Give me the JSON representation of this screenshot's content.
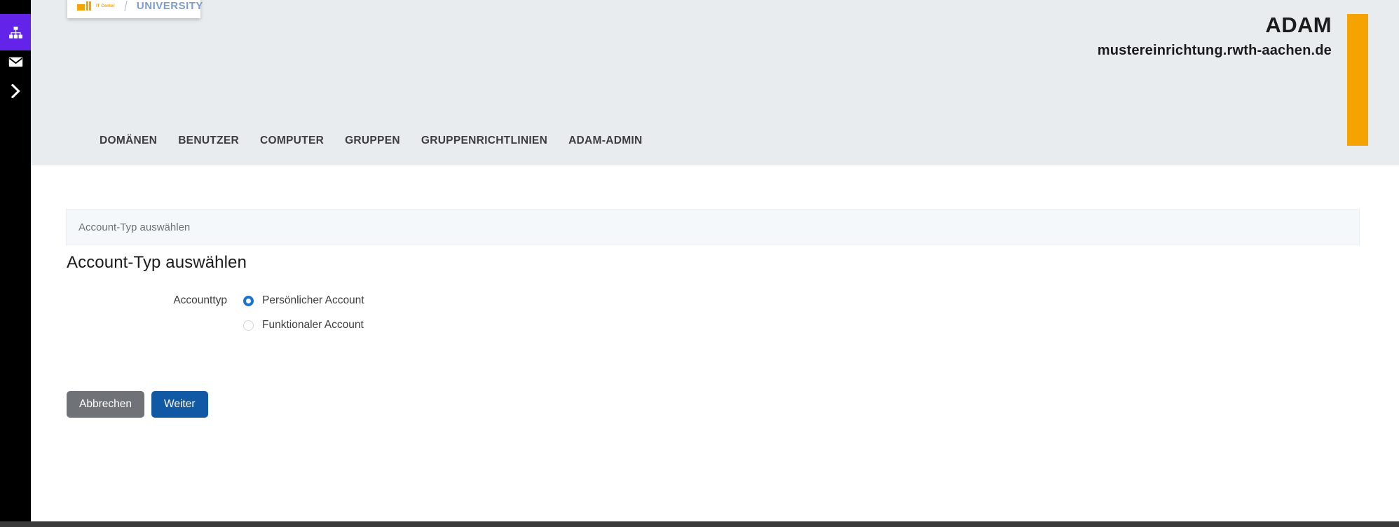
{
  "sidebar": {
    "items": [
      {
        "name": "org-chart",
        "icon": "sitemap-icon",
        "active": true
      },
      {
        "name": "mail",
        "icon": "envelope-icon",
        "active": false
      },
      {
        "name": "expand",
        "icon": "chevron-right-icon",
        "active": false
      }
    ]
  },
  "logo": {
    "it_center_label": "IT Center",
    "university_label": "UNIVERSITY"
  },
  "header": {
    "app_title": "ADAM",
    "host": "mustereinrichtung.rwth-aachen.de",
    "accent_color": "#f5a300",
    "background_color": "#e8ecef"
  },
  "nav": {
    "items": [
      {
        "label": "DOMÄNEN"
      },
      {
        "label": "BENUTZER"
      },
      {
        "label": "COMPUTER"
      },
      {
        "label": "GRUPPEN"
      },
      {
        "label": "GRUPPENRICHTLINIEN"
      },
      {
        "label": "ADAM-ADMIN"
      }
    ]
  },
  "main": {
    "breadcrumb": "Account-Typ auswählen",
    "heading": "Account-Typ auswählen",
    "form": {
      "field_label": "Accounttyp",
      "options": [
        {
          "label": "Persönlicher Account",
          "selected": true
        },
        {
          "label": "Funktionaler Account",
          "selected": false
        }
      ],
      "selected_color": "#1a73d4"
    },
    "buttons": {
      "cancel_label": "Abbrechen",
      "next_label": "Weiter",
      "cancel_color": "#6f7377",
      "next_color": "#1159a5"
    }
  }
}
